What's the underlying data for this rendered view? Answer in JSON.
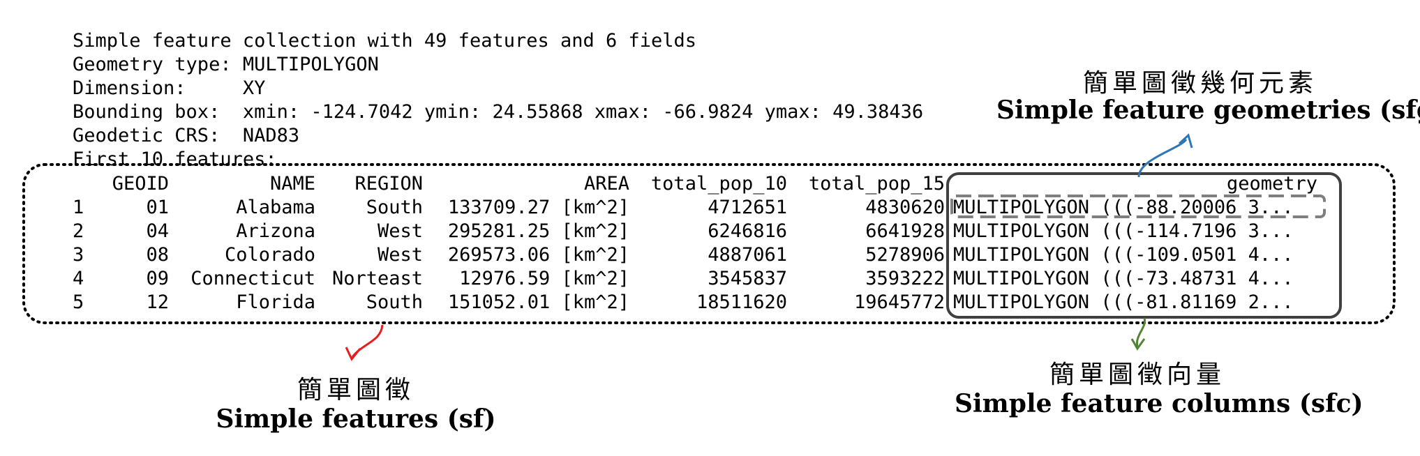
{
  "header": {
    "line1": "Simple feature collection with 49 features and 6 fields",
    "line2": "Geometry type: MULTIPOLYGON",
    "line3": "Dimension:     XY",
    "line4": "Bounding box:  xmin: -124.7042 ymin: 24.55868 xmax: -66.9824 ymax: 49.38436",
    "line5": "Geodetic CRS:  NAD83",
    "line6": "First 10 features:"
  },
  "table": {
    "columns": [
      "",
      "GEOID",
      "NAME",
      "REGION",
      "AREA",
      "total_pop_10",
      "total_pop_15",
      "geometry"
    ],
    "rows": [
      [
        "1",
        "01",
        "Alabama",
        "South",
        "133709.27 [km^2]",
        "4712651",
        "4830620",
        "MULTIPOLYGON (((-88.20006 3..."
      ],
      [
        "2",
        "04",
        "Arizona",
        "West",
        "295281.25 [km^2]",
        "6246816",
        "6641928",
        "MULTIPOLYGON (((-114.7196 3..."
      ],
      [
        "3",
        "08",
        "Colorado",
        "West",
        "269573.06 [km^2]",
        "4887061",
        "5278906",
        "MULTIPOLYGON (((-109.0501 4..."
      ],
      [
        "4",
        "09",
        "Connecticut",
        "Norteast",
        "12976.59 [km^2]",
        "3545837",
        "3593222",
        "MULTIPOLYGON (((-73.48731 4..."
      ],
      [
        "5",
        "12",
        "Florida",
        "South",
        "151052.01 [km^2]",
        "18511620",
        "19645772",
        "MULTIPOLYGON (((-81.81169 2..."
      ]
    ]
  },
  "annotations": {
    "sfg_cjk": "簡單圖徵幾何元素",
    "sfg_en": "Simple feature geometries (sfg)",
    "sf_cjk": "簡單圖徵",
    "sf_en": "Simple features (sf)",
    "sfc_cjk": "簡單圖徵向量",
    "sfc_en": "Simple feature columns (sfc)"
  },
  "colors": {
    "sfg_arrow": "#2e75b6",
    "sf_arrow": "#e81c1c",
    "sfc_arrow": "#548235",
    "box_border": "#404040",
    "dotted_border": "#000000"
  }
}
